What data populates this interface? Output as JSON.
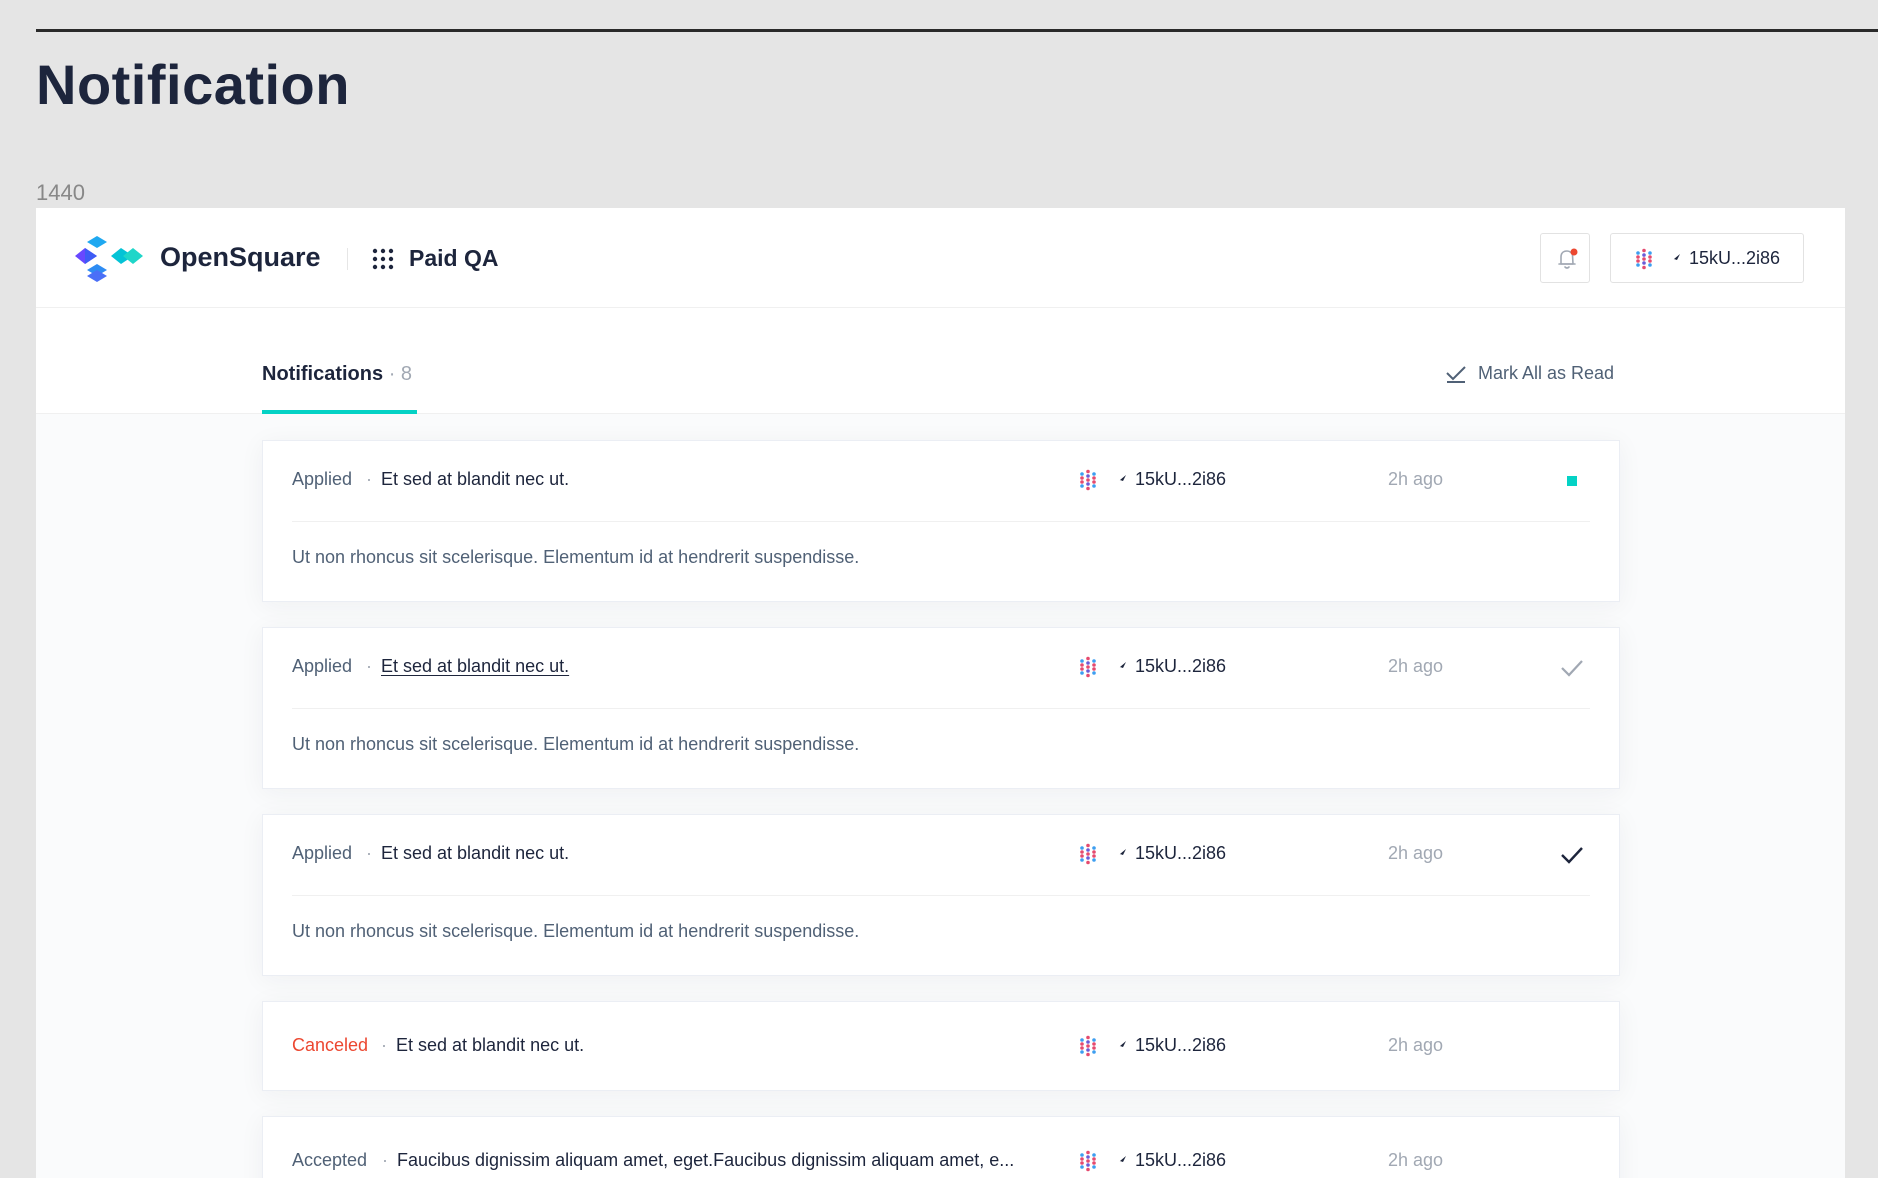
{
  "page": {
    "heading": "Notification",
    "frame_label": "1440"
  },
  "header": {
    "brand": "OpenSquare",
    "app_name": "Paid QA",
    "account": "15kU...2i86",
    "icons": {
      "logo": "opensquare-logo",
      "apps": "grid-dots-icon",
      "bell": "bell-icon",
      "avatar": "polkadot-avatar-icon",
      "chain": "chain-arrow-icon"
    }
  },
  "tabs": {
    "label": "Notifications",
    "count": "· 8",
    "mark_all": "Mark All as Read"
  },
  "colors": {
    "accent": "#04d2c5",
    "canceled": "#ec4730",
    "text": "#1d253c",
    "muted": "#506176",
    "faint": "#a1a8b3",
    "alert_dot": "#ec4730"
  },
  "notifications": [
    {
      "status": "Applied",
      "title": "Et sed at blandit nec ut.",
      "address": "15kU...2i86",
      "time": "2h ago",
      "body": "Ut non rhoncus sit scelerisque. Elementum id at hendrerit suspendisse.",
      "read_state": "unread"
    },
    {
      "status": "Applied",
      "title": "Et sed at blandit nec ut.",
      "address": "15kU...2i86",
      "time": "2h ago",
      "body": "Ut non rhoncus sit scelerisque. Elementum id at hendrerit suspendisse.",
      "read_state": "read-hover"
    },
    {
      "status": "Applied",
      "title": "Et sed at blandit nec ut.",
      "address": "15kU...2i86",
      "time": "2h ago",
      "body": "Ut non rhoncus sit scelerisque. Elementum id at hendrerit suspendisse.",
      "read_state": "read"
    },
    {
      "status": "Canceled",
      "title": "Et sed at blandit nec ut.",
      "address": "15kU...2i86",
      "time": "2h ago"
    },
    {
      "status": "Accepted",
      "title": "Faucibus dignissim aliquam amet, eget.Faucibus dignissim aliquam amet, e...",
      "address": "15kU...2i86",
      "time": "2h ago"
    }
  ]
}
